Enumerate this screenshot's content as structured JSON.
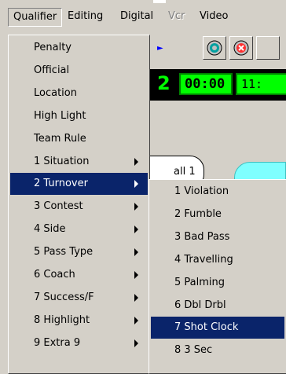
{
  "menubar": {
    "items": [
      "Qualifier",
      "Editing",
      "Digital",
      "Vcr",
      "Video"
    ]
  },
  "background": {
    "period": "2",
    "clock": "00:00",
    "time": "11:",
    "ball_label": "all 1"
  },
  "qualifier_menu": {
    "items": [
      {
        "label": "Penalty",
        "submenu": false
      },
      {
        "label": "Official",
        "submenu": false
      },
      {
        "label": "Location",
        "submenu": false
      },
      {
        "label": "High Light",
        "submenu": false
      },
      {
        "label": "Team Rule",
        "submenu": false
      },
      {
        "label": "1 Situation",
        "submenu": true
      },
      {
        "label": "2 Turnover",
        "submenu": true,
        "selected": true
      },
      {
        "label": "3 Contest",
        "submenu": true
      },
      {
        "label": "4 Side",
        "submenu": true
      },
      {
        "label": "5 Pass Type",
        "submenu": true
      },
      {
        "label": "6 Coach",
        "submenu": true
      },
      {
        "label": "7 Success/F",
        "submenu": true
      },
      {
        "label": "8 Highlight",
        "submenu": true
      },
      {
        "label": "9 Extra 9",
        "submenu": true
      }
    ]
  },
  "turnover_submenu": {
    "items": [
      {
        "label": "1 Violation"
      },
      {
        "label": "2 Fumble"
      },
      {
        "label": "3 Bad Pass"
      },
      {
        "label": "4 Travelling"
      },
      {
        "label": "5 Palming"
      },
      {
        "label": "6 Dbl Drbl"
      },
      {
        "label": "7 Shot Clock",
        "selected": true
      },
      {
        "label": "8 3 Sec"
      }
    ]
  },
  "colors": {
    "menu_bg": "#d4d0c8",
    "highlight": "#0a246a",
    "lcd_green": "#00ff00",
    "cyan": "#7fffff"
  }
}
